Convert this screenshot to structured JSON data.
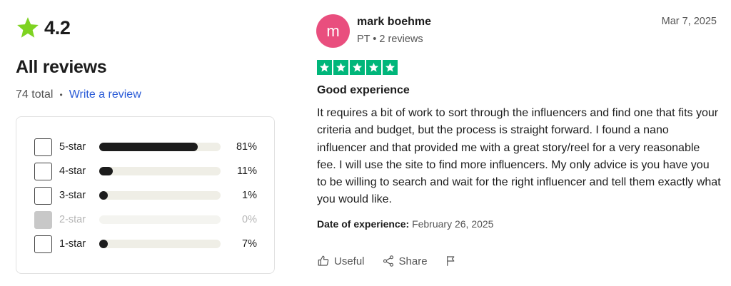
{
  "summary": {
    "rating": "4.2",
    "heading": "All reviews",
    "total": "74 total",
    "separator": "•",
    "write_review": "Write a review"
  },
  "filters": [
    {
      "label": "5-star",
      "percent_text": "81%",
      "fill_fraction": 0.81,
      "disabled": false
    },
    {
      "label": "4-star",
      "percent_text": "11%",
      "fill_fraction": 0.11,
      "disabled": false
    },
    {
      "label": "3-star",
      "percent_text": "1%",
      "fill_fraction": 0.01,
      "disabled": false
    },
    {
      "label": "2-star",
      "percent_text": "0%",
      "fill_fraction": 0.0,
      "disabled": true
    },
    {
      "label": "1-star",
      "percent_text": "7%",
      "fill_fraction": 0.07,
      "disabled": false
    }
  ],
  "review": {
    "avatar_initial": "m",
    "name": "mark boehme",
    "meta": "PT • 2 reviews",
    "date": "Mar 7, 2025",
    "stars": 5,
    "title": "Good experience",
    "body": "It requires a bit of work to sort through the influencers and find one that fits your criteria and budget, but the process is straight forward. I found a nano influencer and that provided me with a great story/reel for a very reasonable fee. I will use the site to find more influencers. My only advice is you have you to be willing to search and wait for the right influencer and tell them exactly what you would like.",
    "experience_label": "Date of experience:",
    "experience_date": "February 26, 2025",
    "actions": {
      "useful": "Useful",
      "share": "Share"
    }
  },
  "colors": {
    "star_green": "#7ed321",
    "trustpilot_green": "#00b67a",
    "avatar": "#e94e7e",
    "link": "#2a5bd7"
  }
}
